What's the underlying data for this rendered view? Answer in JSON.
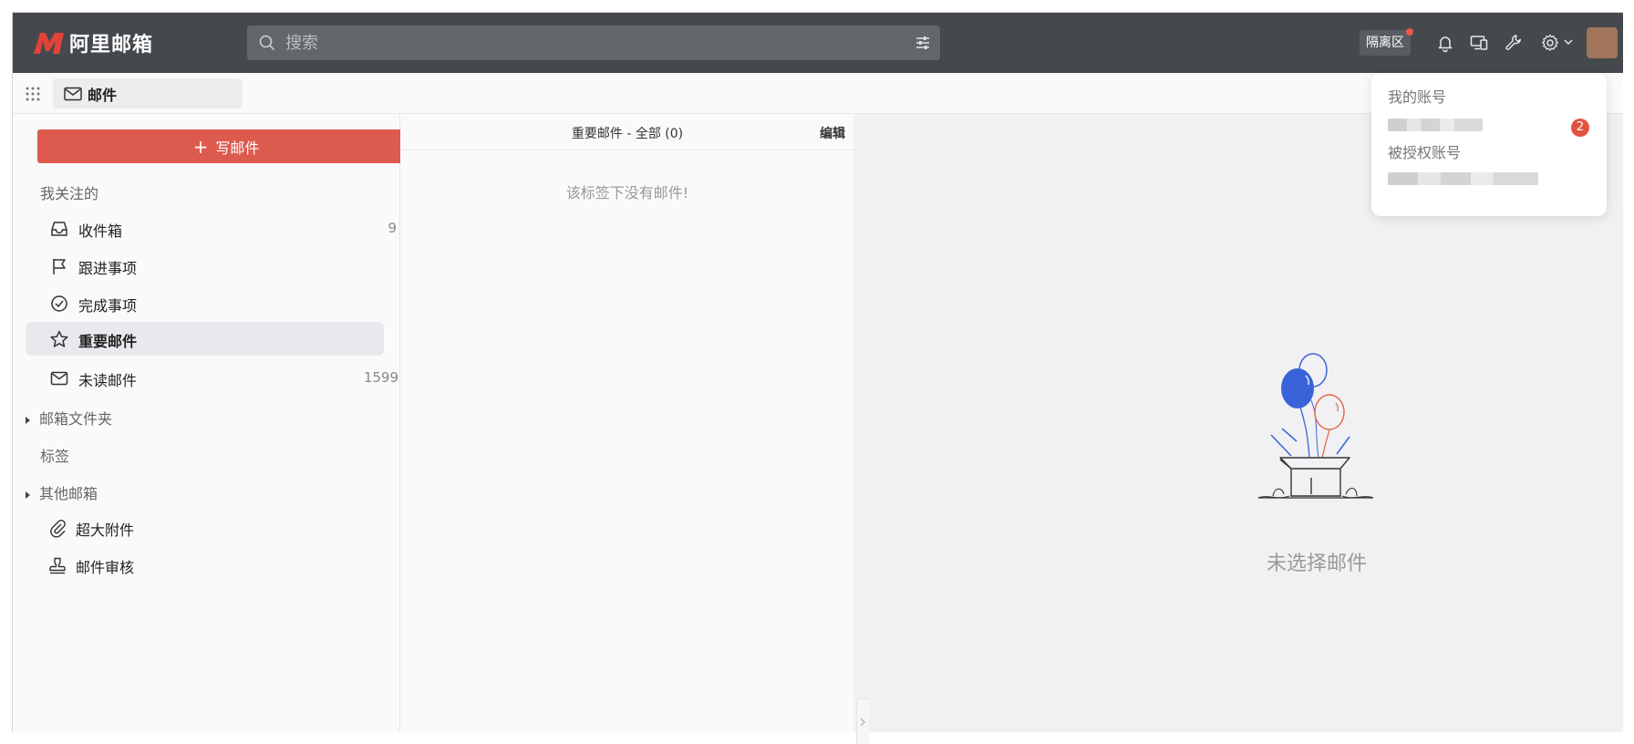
{
  "app": {
    "logo_text": "阿里邮箱",
    "brand_color": "#e0433a"
  },
  "topbar": {
    "search_placeholder": "搜索",
    "quarantine_label": "隔离区",
    "icons": [
      "search-icon",
      "filter-icon",
      "bell-icon",
      "devices-icon",
      "wrench-icon",
      "gear-icon",
      "chevron-down-icon"
    ]
  },
  "subbar": {
    "mail_tab_label": "邮件"
  },
  "sidebar": {
    "compose_label": "写邮件",
    "following_label": "我关注的",
    "items": [
      {
        "label": "收件箱",
        "count": "9",
        "icon": "inbox-icon"
      },
      {
        "label": "跟进事项",
        "count": "",
        "icon": "flag-icon"
      },
      {
        "label": "完成事项",
        "count": "",
        "icon": "check-circle-icon"
      },
      {
        "label": "重要邮件",
        "count": "",
        "icon": "star-icon",
        "active": true
      },
      {
        "label": "未读邮件",
        "count": "1599",
        "icon": "mail-icon"
      }
    ],
    "folders_label": "邮箱文件夹",
    "tags_label": "标签",
    "other_mailboxes_label": "其他邮箱",
    "tools": [
      {
        "label": "超大附件",
        "icon": "paperclip-icon"
      },
      {
        "label": "邮件审核",
        "icon": "stamp-icon"
      }
    ]
  },
  "list": {
    "header_title": "重要邮件 - 全部 (0)",
    "edit_label": "编辑",
    "empty_message": "该标签下没有邮件!"
  },
  "pane": {
    "no_selection": "未选择邮件"
  },
  "account_dropdown": {
    "my_account_label": "我的账号",
    "badge_count": "2",
    "authorized_label": "被授权账号"
  }
}
